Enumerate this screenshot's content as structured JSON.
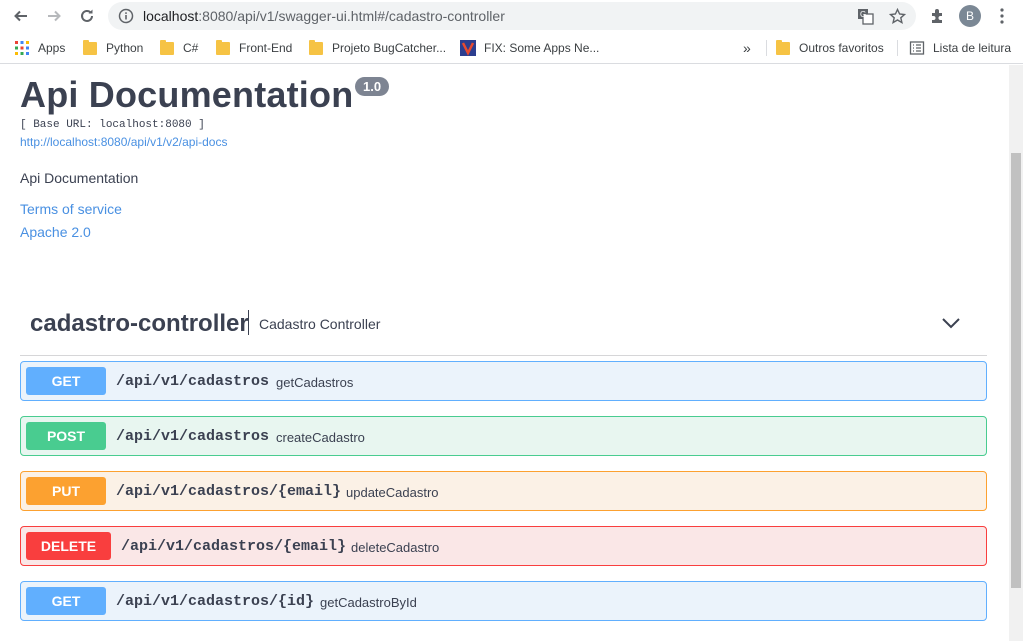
{
  "browser": {
    "url_host": "localhost",
    "url_rest": ":8080/api/v1/swagger-ui.html#/cadastro-controller",
    "profile_initial": "B"
  },
  "bookmarks": {
    "apps": "Apps",
    "items": [
      "Python",
      "C#",
      "Front-End",
      "Projeto BugCatcher...",
      "FIX: Some Apps Ne..."
    ],
    "overflow": "»",
    "other": "Outros favoritos",
    "reading_list": "Lista de leitura"
  },
  "api": {
    "title": "Api Documentation",
    "version": "1.0",
    "base_url": "[ Base URL: localhost:8080 ]",
    "docs_link": "http://localhost:8080/api/v1/v2/api-docs",
    "description": "Api Documentation",
    "terms": "Terms of service",
    "license": "Apache 2.0"
  },
  "controller": {
    "name": "cadastro-controller",
    "description": "Cadastro Controller"
  },
  "operations": [
    {
      "method": "GET",
      "path": "/api/v1/cadastros",
      "summary": "getCadastros"
    },
    {
      "method": "POST",
      "path": "/api/v1/cadastros",
      "summary": "createCadastro"
    },
    {
      "method": "PUT",
      "path": "/api/v1/cadastros/{email}",
      "summary": "updateCadastro"
    },
    {
      "method": "DELETE",
      "path": "/api/v1/cadastros/{email}",
      "summary": "deleteCadastro"
    },
    {
      "method": "GET",
      "path": "/api/v1/cadastros/{id}",
      "summary": "getCadastroById"
    }
  ],
  "colors": {
    "get": "#61affe",
    "post": "#49cc90",
    "put": "#fca130",
    "delete": "#f93e3e",
    "text": "#3b4151",
    "link": "#4990e2"
  }
}
